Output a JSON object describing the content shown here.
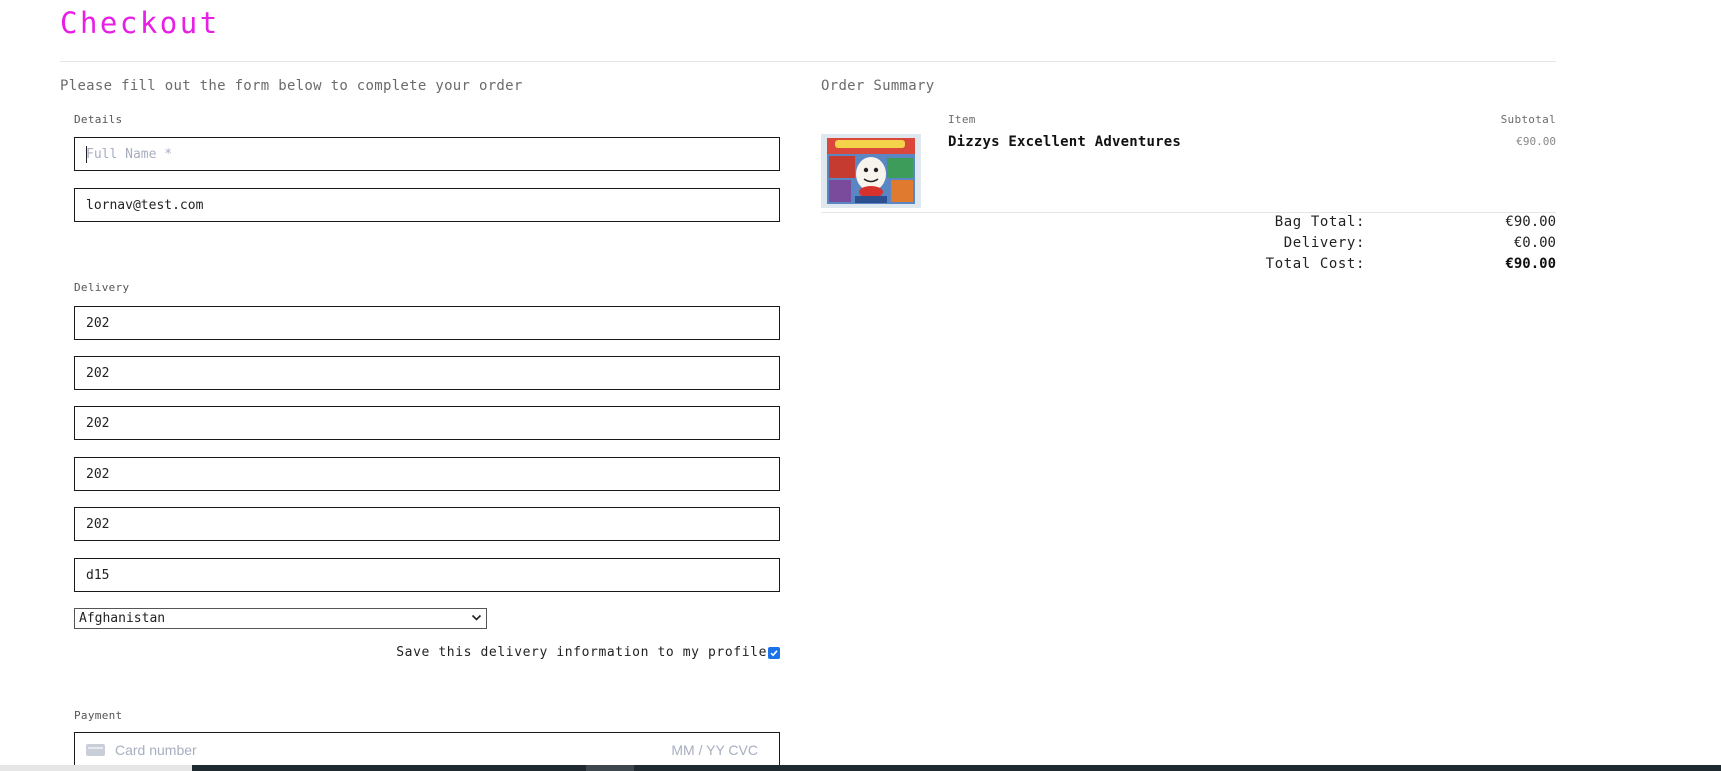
{
  "page": {
    "title": "Checkout",
    "intro": "Please fill out the form below to complete your order"
  },
  "details": {
    "legend": "Details",
    "full_name": {
      "value": "",
      "placeholder": "Full Name *"
    },
    "email": {
      "value": "lornav@test.com"
    }
  },
  "delivery": {
    "legend": "Delivery",
    "fields": [
      {
        "value": "202"
      },
      {
        "value": "202"
      },
      {
        "value": "202"
      },
      {
        "value": "202"
      },
      {
        "value": "202"
      },
      {
        "value": "d15"
      }
    ],
    "country": "Afghanistan",
    "save_label": "Save this delivery information to my profile",
    "save_checked": true
  },
  "payment": {
    "legend": "Payment",
    "card_placeholder": "Card number",
    "expiry_cvc_placeholder": "MM / YY  CVC"
  },
  "summary": {
    "title": "Order Summary",
    "col_item": "Item",
    "col_subtotal": "Subtotal",
    "items": [
      {
        "name": "Dizzys Excellent Adventures",
        "subtotal": "€90.00"
      }
    ],
    "bag_total_label": "Bag Total:",
    "bag_total": "€90.00",
    "delivery_label": "Delivery:",
    "delivery": "€0.00",
    "total_label": "Total Cost:",
    "total": "€90.00"
  },
  "colors": {
    "title": "#e81ee5",
    "checkbox": "#1a73e8",
    "placeholder": "#a8aec0"
  }
}
